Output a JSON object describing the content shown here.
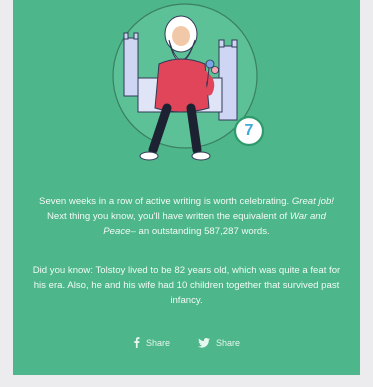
{
  "badge": {
    "number": "7"
  },
  "message": {
    "intro": "Seven weeks in a row of active writing is worth celebrating.",
    "praise": "Great job!",
    "equivalent_prefix": "Next thing you know, you'll have written the equivalent of",
    "book_title": "War and Peace",
    "equivalent_suffix": "– an outstanding 587,287 words."
  },
  "fact": {
    "text": "Did you know: Tolstoy lived to be 82 years old, which was quite a feat for his era. Also, he and his wife had 10 children together that survived past infancy."
  },
  "share": {
    "facebook_label": "Share",
    "twitter_label": "Share"
  },
  "icons": {
    "facebook": "facebook-icon",
    "twitter": "twitter-icon"
  },
  "colors": {
    "card_background": "#4db68a",
    "badge_accent": "#3fa9d6",
    "coat": "#e0455a"
  }
}
